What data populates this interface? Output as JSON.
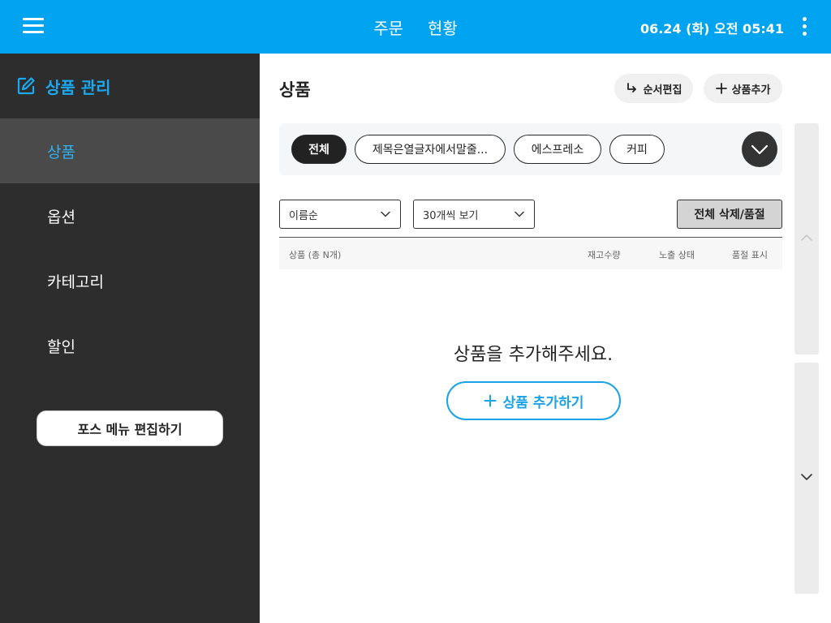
{
  "topbar": {
    "menu_icon": "hamburger-icon",
    "tabs": [
      {
        "label": "주문"
      },
      {
        "label": "현황"
      }
    ],
    "datetime": "06.24 (화) 오전 05:41",
    "more_icon": "vertical-dots-icon",
    "background_color": "#00a3ef"
  },
  "sidebar": {
    "header_icon": "edit-icon",
    "title": "상품 관리",
    "items": [
      {
        "label": "상품",
        "active": true
      },
      {
        "label": "옵션",
        "active": false
      },
      {
        "label": "카테고리",
        "active": false
      },
      {
        "label": "할인",
        "active": false
      }
    ],
    "pos_button_label": "포스 메뉴 편집하기",
    "background_color": "#2d2d2d",
    "accent_color": "#1aa9f0"
  },
  "main": {
    "title": "상품",
    "reorder_button": {
      "label": "순서편집",
      "icon": "return-arrow-icon"
    },
    "add_button": {
      "label": "상품추가",
      "icon": "plus-icon"
    },
    "category_chips": [
      {
        "label": "전체",
        "active": true
      },
      {
        "label": "제목은열글자에서말줄...",
        "active": false
      },
      {
        "label": "에스프레소",
        "active": false
      },
      {
        "label": "커피",
        "active": false
      }
    ],
    "expand_icon": "chevron-down-icon",
    "sort_select": {
      "value": "이름순"
    },
    "page_size_select": {
      "value": "30개씩 보기"
    },
    "bulk_action_label": "전체 삭제/품절",
    "table_headers": [
      "상품 (총 N개)",
      "재고수량",
      "노출 상태",
      "품절 표시"
    ],
    "empty_message": "상품을 추가해주세요.",
    "empty_add_button_label": "상품 추가하기"
  },
  "scroll": {
    "up_icon": "chevron-up-icon",
    "down_icon": "chevron-down-icon"
  }
}
